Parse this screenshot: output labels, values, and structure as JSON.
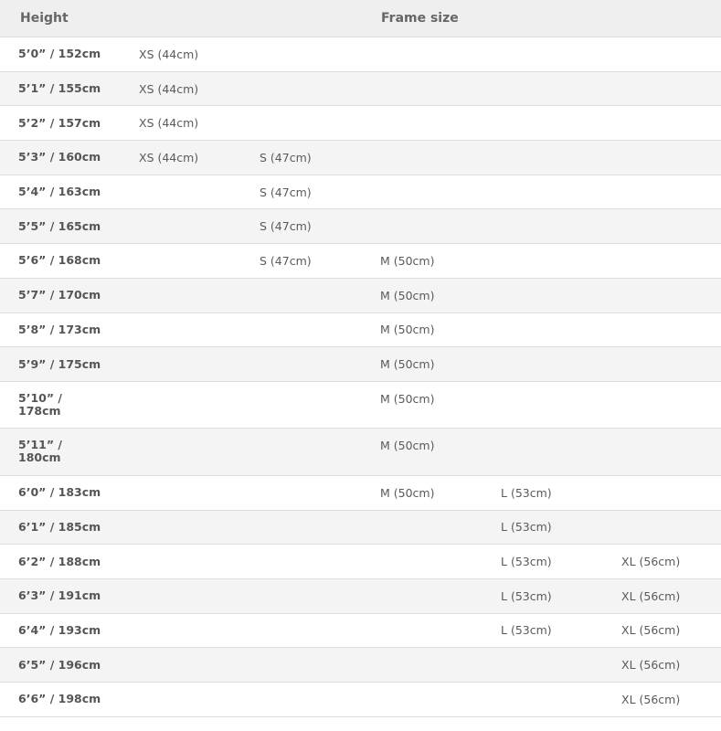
{
  "headers": {
    "height": "Height",
    "frame_size": "Frame size"
  },
  "rows": [
    {
      "height": "5’0” / 152cm",
      "sizes": [
        "XS (44cm)",
        "",
        "",
        "",
        ""
      ]
    },
    {
      "height": "5’1” / 155cm",
      "sizes": [
        "XS (44cm)",
        "",
        "",
        "",
        ""
      ]
    },
    {
      "height": "5’2” / 157cm",
      "sizes": [
        "XS (44cm)",
        "",
        "",
        "",
        ""
      ]
    },
    {
      "height": "5’3” / 160cm",
      "sizes": [
        "XS (44cm)",
        "S (47cm)",
        "",
        "",
        ""
      ]
    },
    {
      "height": "5’4” / 163cm",
      "sizes": [
        "",
        "S (47cm)",
        "",
        "",
        ""
      ]
    },
    {
      "height": "5’5” / 165cm",
      "sizes": [
        "",
        "S (47cm)",
        "",
        "",
        ""
      ]
    },
    {
      "height": "5’6” / 168cm",
      "sizes": [
        "",
        "S (47cm)",
        "M (50cm)",
        "",
        ""
      ]
    },
    {
      "height": "5’7” / 170cm",
      "sizes": [
        "",
        "",
        "M (50cm)",
        "",
        ""
      ]
    },
    {
      "height": "5’8” / 173cm",
      "sizes": [
        "",
        "",
        "M (50cm)",
        "",
        ""
      ]
    },
    {
      "height": "5’9” / 175cm",
      "sizes": [
        "",
        "",
        "M (50cm)",
        "",
        ""
      ]
    },
    {
      "height": "5’10” /",
      "height2": "178cm",
      "sizes": [
        "",
        "",
        "M (50cm)",
        "",
        ""
      ]
    },
    {
      "height": "5’11” /",
      "height2": "180cm",
      "sizes": [
        "",
        "",
        "M (50cm)",
        "",
        ""
      ]
    },
    {
      "height": "6’0” / 183cm",
      "sizes": [
        "",
        "",
        "M (50cm)",
        "L (53cm)",
        ""
      ]
    },
    {
      "height": "6’1” / 185cm",
      "sizes": [
        "",
        "",
        "",
        "L (53cm)",
        ""
      ]
    },
    {
      "height": "6’2” / 188cm",
      "sizes": [
        "",
        "",
        "",
        "L (53cm)",
        "XL (56cm)"
      ]
    },
    {
      "height": "6’3” / 191cm",
      "sizes": [
        "",
        "",
        "",
        "L (53cm)",
        "XL (56cm)"
      ]
    },
    {
      "height": "6’4” / 193cm",
      "sizes": [
        "",
        "",
        "",
        "L (53cm)",
        "XL (56cm)"
      ]
    },
    {
      "height": "6’5” / 196cm",
      "sizes": [
        "",
        "",
        "",
        "",
        "XL (56cm)"
      ]
    },
    {
      "height": "6’6” / 198cm",
      "sizes": [
        "",
        "",
        "",
        "",
        "XL (56cm)"
      ]
    }
  ]
}
